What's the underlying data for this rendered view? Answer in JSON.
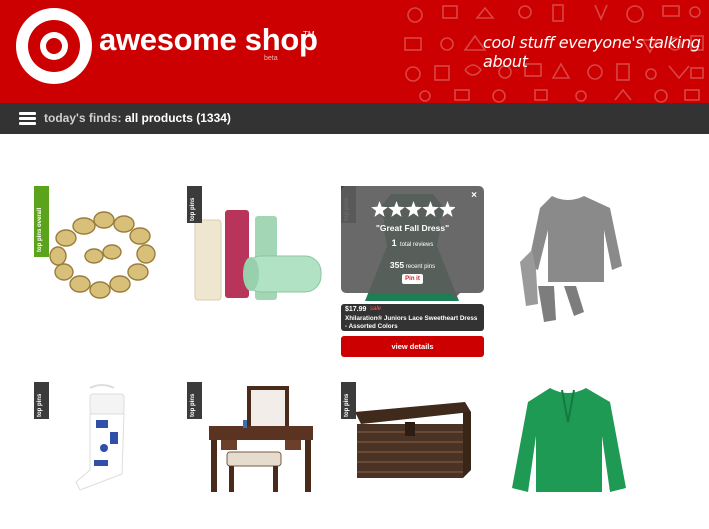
{
  "header": {
    "brand": "awesome shop",
    "trademark": "TM",
    "beta_label": "beta",
    "tagline": "cool stuff everyone's talking about",
    "brand_color": "#cc0000"
  },
  "navbar": {
    "menu_icon": "hamburger-menu-icon",
    "finds_label": "today's finds:",
    "finds_value": "all products (1334)"
  },
  "ribbons": {
    "overall": "top pins overall",
    "standard": "top pins",
    "overall_color": "#5aa31a",
    "standard_color": "#3b3b3b"
  },
  "products": [
    {
      "image": "gold-chain-bracelet",
      "ribbon": "top pins overall"
    },
    {
      "image": "lip-balm-tubes",
      "ribbon": "top pins"
    },
    {
      "image": "green-lace-dress",
      "ribbon": "top pins"
    },
    {
      "image": "gray-knit-sweater",
      "ribbon": ""
    },
    {
      "image": "r2d2-christmas-stocking",
      "ribbon": "top pins"
    },
    {
      "image": "vanity-desk-with-stool",
      "ribbon": "top pins"
    },
    {
      "image": "wicker-storage-trunk",
      "ribbon": "top pins"
    },
    {
      "image": "green-blouse",
      "ribbon": ""
    }
  ],
  "popup": {
    "rating": 5,
    "title": "\"Great Fall Dress\"",
    "total_reviews": "1",
    "total_reviews_label": "total reviews",
    "recent_pins": "355",
    "recent_pins_label": "recent pins",
    "pin_it_label": "Pin it",
    "close": "×"
  },
  "featured": {
    "price": "$17.99",
    "sale": "sale",
    "name": "Xhilaration® Juniors Lace Sweetheart Dress - Assorted Colors",
    "view_details": "view details"
  }
}
